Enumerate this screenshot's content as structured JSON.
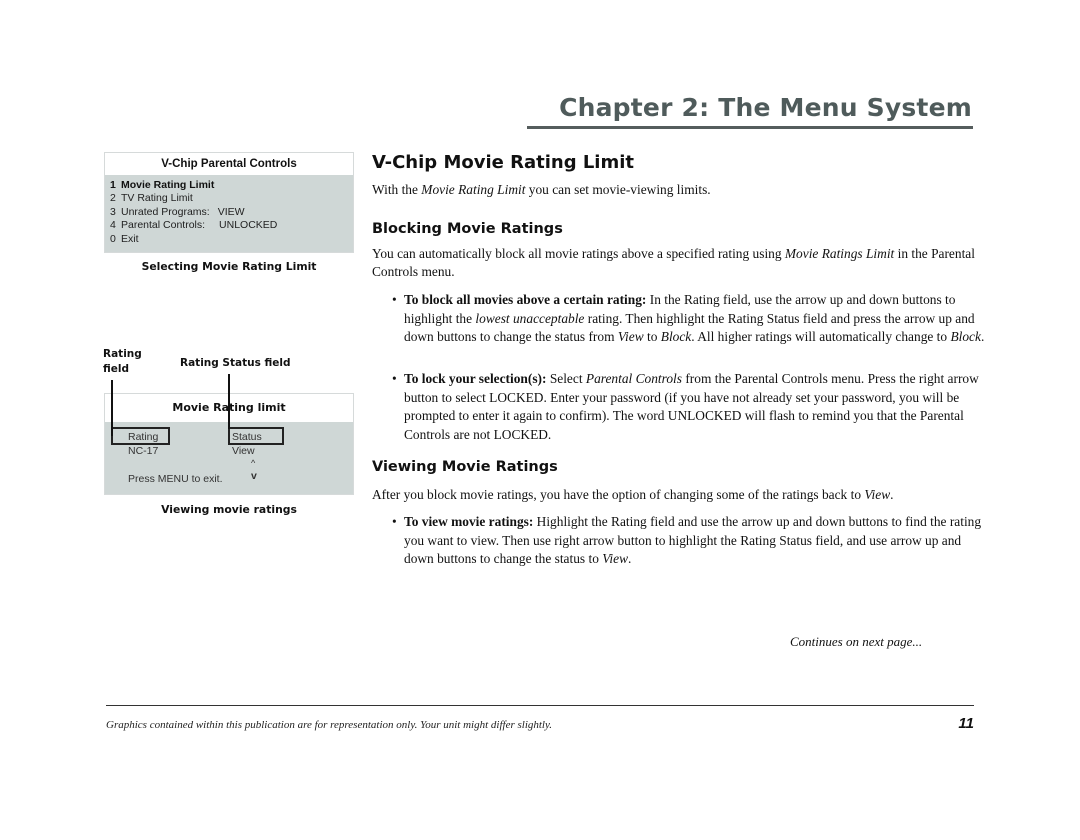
{
  "header": {
    "chapter_title": "Chapter 2: The Menu System"
  },
  "sidebar": {
    "menu_panel": {
      "title": "V-Chip Parental Controls",
      "items": [
        {
          "num": "1",
          "label": "Movie Rating Limit",
          "value": "",
          "selected": true
        },
        {
          "num": "2",
          "label": "TV Rating Limit",
          "value": "",
          "selected": false
        },
        {
          "num": "3",
          "label": "Unrated Programs:",
          "value": "VIEW",
          "selected": false
        },
        {
          "num": "4",
          "label": "Parental Controls:",
          "value": "UNLOCKED",
          "selected": false
        },
        {
          "num": "0",
          "label": "Exit",
          "value": "",
          "selected": false
        }
      ],
      "caption": "Selecting Movie Rating Limit"
    },
    "rating_panel": {
      "callout_rating_field": "Rating field",
      "callout_rating_field_line1": "Rating",
      "callout_rating_field_line2": "field",
      "callout_status_field": "Rating Status field",
      "title": "Movie Rating limit",
      "rating_header": "Rating",
      "status_header": "Status",
      "rating_value": "NC-17",
      "status_value": "View",
      "arrow_up": "^",
      "arrow_down": "v",
      "exit_hint": "Press MENU to exit.",
      "caption": "Viewing movie ratings"
    }
  },
  "main": {
    "title": "V-Chip Movie Rating Limit",
    "intro": {
      "pre": "With the ",
      "em": "Movie Rating Limit",
      "post": " you can set movie-viewing limits."
    },
    "blocking": {
      "heading": "Blocking Movie Ratings",
      "para_pre": "You can automatically block all movie ratings above a specified rating using ",
      "para_em": "Movie Ratings Limit",
      "para_post": " in the Parental Controls menu.",
      "bullets": [
        {
          "lead": "To block all movies above a certain rating:",
          "t1": " In the Rating field, use the arrow up and down buttons to highlight the ",
          "e1": "lowest unacceptable",
          "t2": " rating. Then highlight the Rating Status field and press the arrow up and down buttons to change the status from ",
          "e2": "View",
          "t3": " to ",
          "e3": "Block",
          "t4": ". All higher ratings will automatically change to ",
          "e4": "Block",
          "t5": "."
        },
        {
          "lead": "To lock your selection(s):",
          "t1": " Select ",
          "e1": "Parental Controls",
          "t2": " from the Parental Controls menu. Press the right arrow button to select LOCKED. Enter your password (if you have not already set your password, you will be prompted to enter it again to confirm). The word UNLOCKED will flash to remind you that the Parental Controls are not LOCKED."
        }
      ]
    },
    "viewing": {
      "heading": "Viewing Movie Ratings",
      "para_pre": "After you block movie ratings, you have the option of changing some of the ratings back to ",
      "para_em": "View",
      "para_post": ".",
      "bullets": [
        {
          "lead": "To view movie ratings:",
          "t1": " Highlight the Rating field and use the arrow up and down buttons to find the rating you want to view. Then use right arrow button to highlight the Rating Status field, and use arrow up and down buttons to change the status to ",
          "e1": "View",
          "t2": "."
        }
      ]
    },
    "continues": "Continues on next page..."
  },
  "footer": {
    "note": "Graphics contained within this publication are for representation only. Your unit might differ slightly.",
    "page_number": "11"
  }
}
